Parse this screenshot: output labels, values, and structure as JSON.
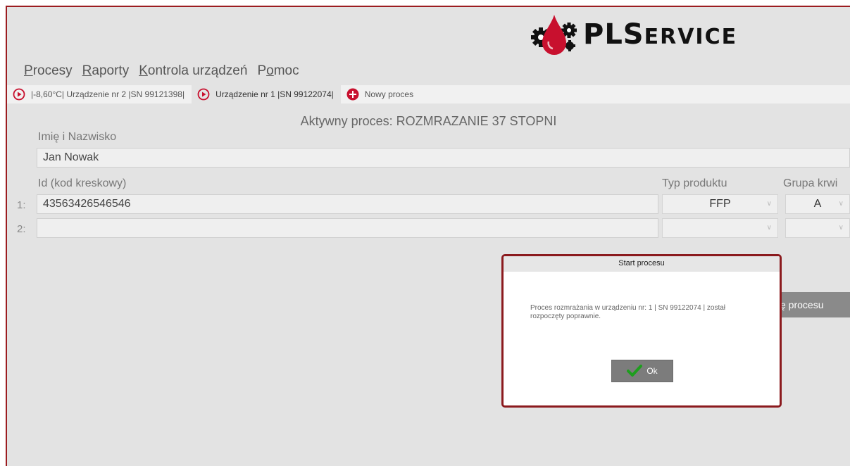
{
  "logo": {
    "brand_main": "PLS",
    "brand_small": "ERVICE"
  },
  "menu": [
    {
      "first": "P",
      "rest": "rocesy"
    },
    {
      "first": "R",
      "rest": "aporty"
    },
    {
      "first": "K",
      "rest": "ontrola urządzeń"
    },
    {
      "pre": "P",
      "first": "o",
      "rest": "moc"
    }
  ],
  "tabs": [
    {
      "label": "|-8,60°C| Urządzenie nr 2 |SN 99121398|",
      "icon": "play-circle-icon"
    },
    {
      "label": "Urządzenie nr 1 |SN 99122074|",
      "icon": "play-circle-icon",
      "active": true
    },
    {
      "label": "Nowy proces",
      "icon": "plus-circle-icon"
    }
  ],
  "form": {
    "active_process": "Aktywny proces: ROZMRAZANIE 37 STOPNI",
    "name_label": "Imię i Nazwisko",
    "name_value": "Jan Nowak",
    "id_label": "Id (kod kreskowy)",
    "product_label": "Typ produktu",
    "blood_label": "Grupa krwi",
    "rows": [
      {
        "num": "1:",
        "id": "43563426546546",
        "product": "FFP",
        "blood": "A"
      },
      {
        "num": "2:",
        "id": "",
        "product": "",
        "blood": ""
      }
    ],
    "behind_button": "ę procesu"
  },
  "dialog": {
    "title": "Start procesu",
    "message": "Proces rozmrażania w urządzeniu nr: 1 | SN 99122074 | został rozpoczęty poprawnie.",
    "ok_label": "Ok"
  },
  "colors": {
    "accent_red": "#c8102e",
    "frame": "#9b1c20",
    "check_green": "#1e9e1e"
  }
}
